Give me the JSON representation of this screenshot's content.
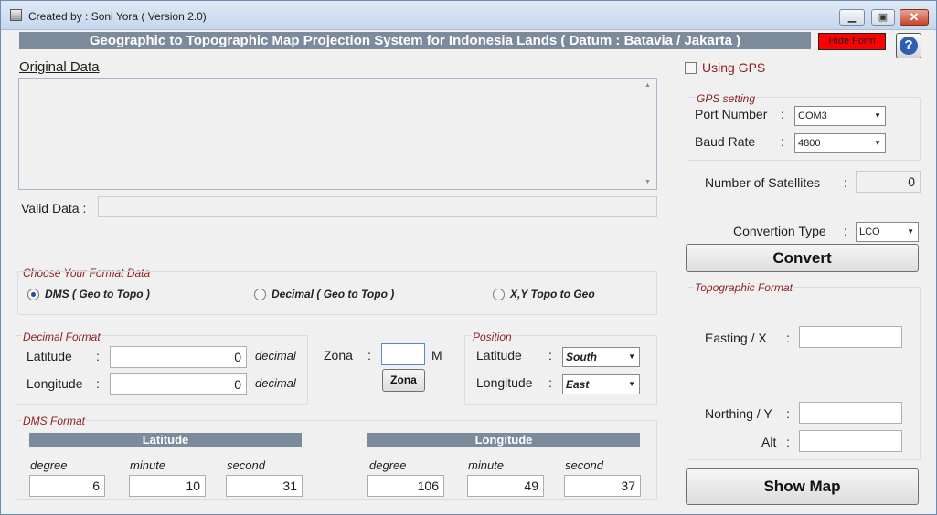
{
  "window": {
    "title": "Created by : Soni Yora ( Version 2.0)",
    "minimize": "▁",
    "maximize": "▣",
    "close": "✕"
  },
  "header": {
    "title": "Geographic to Topographic Map Projection System for Indonesia Lands ( Datum : Batavia / Jakarta )",
    "hide_form": "Hide Form",
    "help": "?"
  },
  "original_data": {
    "label": "Original Data",
    "value": ""
  },
  "valid_data": {
    "label": "Valid Data :",
    "value": ""
  },
  "gps": {
    "using_gps_label": "Using GPS",
    "using_gps_checked": false,
    "setting_title": "GPS setting",
    "port_label": "Port Number",
    "port_value": "COM3",
    "baud_label": "Baud Rate",
    "baud_value": "4800",
    "satellites_label": "Number of Satellites",
    "satellites_value": "0"
  },
  "convert": {
    "type_label": "Convertion Type",
    "type_value": "LCO",
    "button": "Convert"
  },
  "colon": ":",
  "format_choice": {
    "title": "Choose Your Format Data",
    "options": [
      {
        "label": "DMS ( Geo to Topo )",
        "selected": true
      },
      {
        "label": "Decimal ( Geo to Topo )",
        "selected": false
      },
      {
        "label": "X,Y Topo to Geo",
        "selected": false
      }
    ]
  },
  "decimal_format": {
    "title": "Decimal Format",
    "latitude_label": "Latitude",
    "latitude_value": "0",
    "longitude_label": "Longitude",
    "longitude_value": "0",
    "unit": "decimal"
  },
  "zona": {
    "label": "Zona",
    "value": "",
    "suffix": "M",
    "button": "Zona"
  },
  "position": {
    "title": "Position",
    "latitude_label": "Latitude",
    "latitude_value": "South",
    "longitude_label": "Longitude",
    "longitude_value": "East"
  },
  "dms_format": {
    "title": "DMS Format",
    "latitude_header": "Latitude",
    "longitude_header": "Longitude",
    "degree_label": "degree",
    "minute_label": "minute",
    "second_label": "second",
    "lat_degree": "6",
    "lat_minute": "10",
    "lat_second": "31",
    "lon_degree": "106",
    "lon_minute": "49",
    "lon_second": "37"
  },
  "topographic": {
    "title": "Topographic Format",
    "easting_label": "Easting / X",
    "easting_value": "",
    "northing_label": "Northing / Y",
    "northing_value": "",
    "alt_label": "Alt",
    "alt_value": ""
  },
  "show_map": "Show Map"
}
